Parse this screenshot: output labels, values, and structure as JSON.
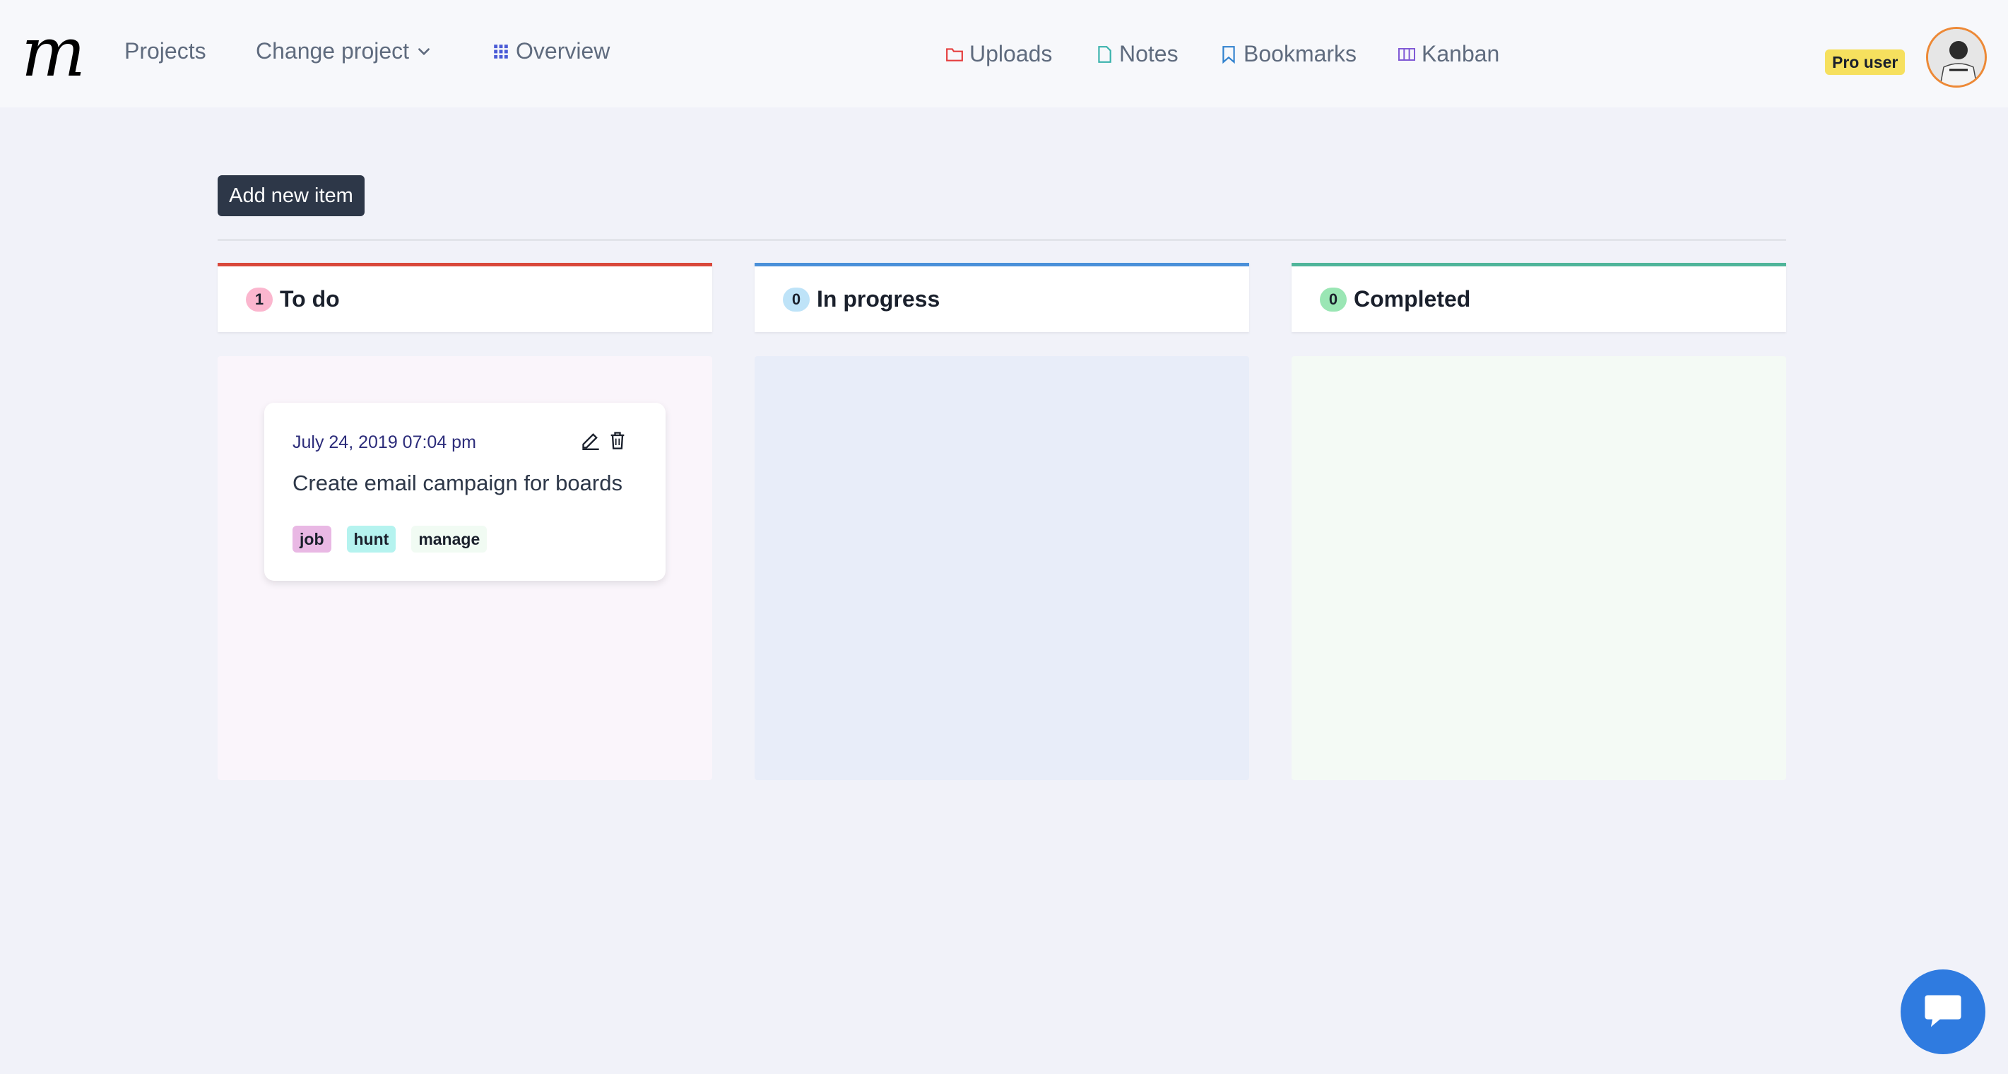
{
  "header": {
    "logo_text": "m",
    "nav": {
      "projects": "Projects",
      "change_project": "Change project",
      "overview": "Overview"
    },
    "center_nav": [
      {
        "label": "Uploads",
        "icon": "folder-icon",
        "color": "#e53e3e"
      },
      {
        "label": "Notes",
        "icon": "note-icon",
        "color": "#38b2ac"
      },
      {
        "label": "Bookmarks",
        "icon": "bookmark-icon",
        "color": "#3182ce"
      },
      {
        "label": "Kanban",
        "icon": "kanban-icon",
        "color": "#805ad5"
      }
    ],
    "badge": "Pro user"
  },
  "toolbar": {
    "add_label": "Add new item"
  },
  "columns": [
    {
      "title": "To do",
      "count": "1",
      "accent": "#d9483b",
      "badge_bg": "#fbb6ce",
      "body_bg": "#faf5fb"
    },
    {
      "title": "In progress",
      "count": "0",
      "accent": "#4a90d9",
      "badge_bg": "#bee3f8",
      "body_bg": "#e8edf9"
    },
    {
      "title": "Completed",
      "count": "0",
      "accent": "#4fb59a",
      "badge_bg": "#9ae6b4",
      "body_bg": "#f4faf5"
    }
  ],
  "card": {
    "date": "July 24, 2019 07:04 pm",
    "title": "Create email campaign for boards",
    "tags": [
      {
        "label": "job",
        "bg": "#e9b8e4"
      },
      {
        "label": "hunt",
        "bg": "#b5f3ef"
      },
      {
        "label": "manage",
        "bg": "#f1fbf3"
      }
    ]
  }
}
